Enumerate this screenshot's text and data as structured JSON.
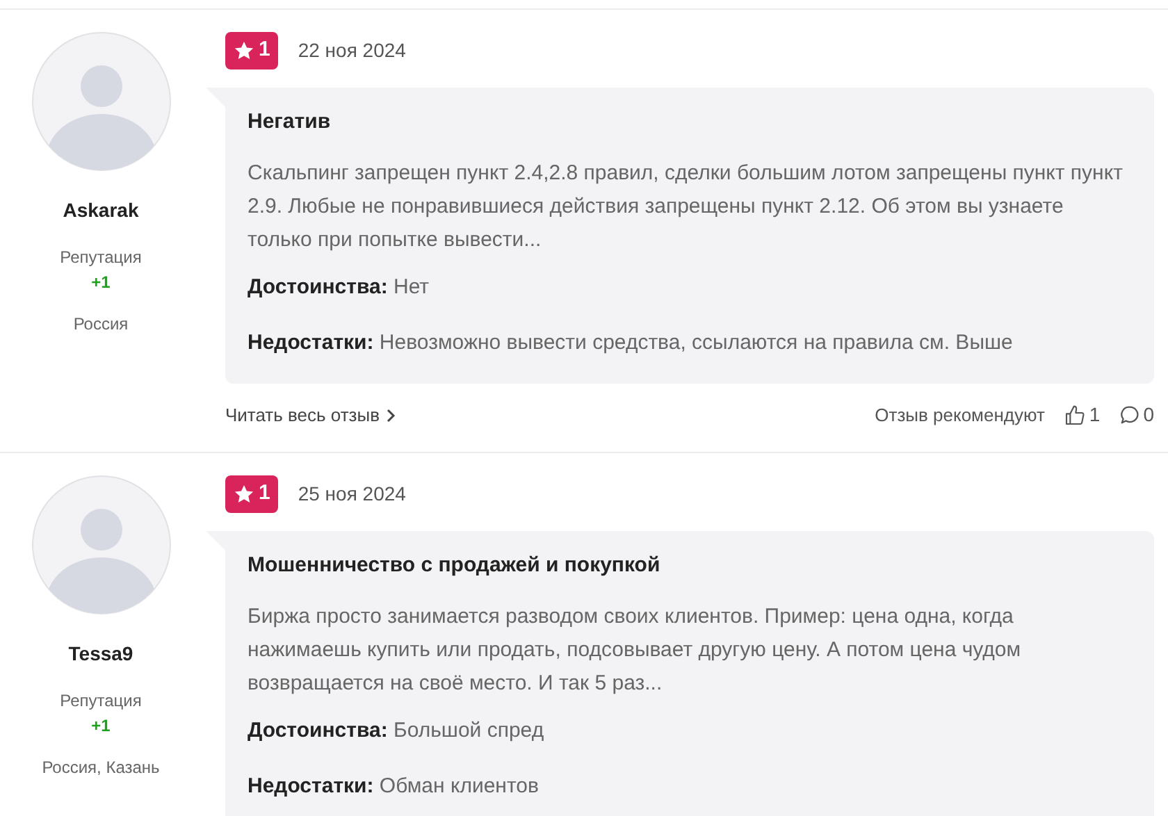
{
  "reviews": [
    {
      "author": "Askarak",
      "reputation_label": "Репутация",
      "reputation": "+1",
      "location": "Россия",
      "rating": "1",
      "date": "22 ноя 2024",
      "title": "Негатив",
      "text": "Скальпинг запрещен пункт 2.4,2.8 правил, сделки большим лотом запрещены пункт пункт 2.9. Любые не понравившиеся действия запрещены пункт 2.12. Об этом вы узнаете только при попытке вывести...",
      "pros": "**Достоинства:** Нет",
      "cons": "**Недостатки:** Невозможно вывести средства, ссылаются на правила см. Выше",
      "read_more": "Читать весь отзыв",
      "recommend_label": "Отзыв рекомендуют",
      "likes": "1",
      "comments": "0"
    },
    {
      "author": "Tessa9",
      "reputation_label": "Репутация",
      "reputation": "+1",
      "location": "Россия, Казань",
      "rating": "1",
      "date": "25 ноя 2024",
      "title": "Мошенничество с продажей и покупкой",
      "text": "Биржа просто занимается разводом своих клиентов. Пример: цена одна, когда нажимаешь купить или продать, подсовывает другую цену. А потом цена чудом возвращается на своё место. И так 5 раз...",
      "pros": "**Достоинства:** Большой спред",
      "cons": "**Недостатки:** Обман клиентов"
    }
  ]
}
